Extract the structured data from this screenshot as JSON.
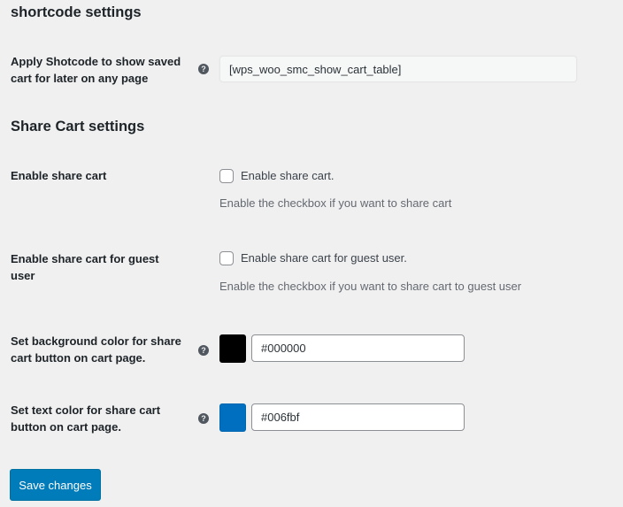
{
  "sections": {
    "shortcode": {
      "title": "shortcode settings"
    },
    "share_cart": {
      "title": "Share Cart settings"
    }
  },
  "shortcode_field": {
    "label": "Apply Shotcode to show saved cart for later on any page",
    "help_icon": "question-circle-icon",
    "help_glyph": "?",
    "value": "[wps_woo_smc_show_cart_table]"
  },
  "enable_share_cart": {
    "label": "Enable share cart",
    "checkbox_label": "Enable share cart.",
    "checked": false,
    "description": "Enable the checkbox if you want to share cart"
  },
  "enable_guest_share": {
    "label": "Enable share cart for guest user",
    "checkbox_label": "Enable share cart for guest user.",
    "checked": false,
    "description": "Enable the checkbox if you want to share cart to guest user"
  },
  "bg_color_field": {
    "label": "Set background color for share cart button on cart page.",
    "help_glyph": "?",
    "value": "#000000",
    "swatch_color": "#000000"
  },
  "text_color_field": {
    "label": "Set text color for share cart button on cart page.",
    "help_glyph": "?",
    "value": "#006fbf",
    "swatch_color": "#006fbf"
  },
  "save_button": {
    "label": "Save changes",
    "color": "#007cba"
  }
}
